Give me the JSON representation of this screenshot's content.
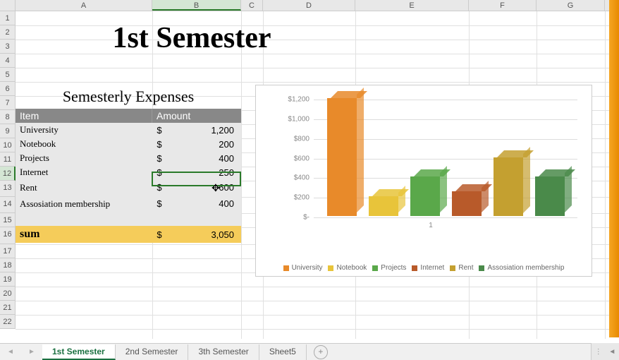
{
  "columns": [
    "A",
    "B",
    "C",
    "D",
    "E",
    "F",
    "G"
  ],
  "active_cell": {
    "col": "B",
    "row": 12
  },
  "title": "1st Semester",
  "table": {
    "title": "Semesterly Expenses",
    "header": {
      "item": "Item",
      "amount": "Amount"
    },
    "rows": [
      {
        "item": "University",
        "currency": "$",
        "amount": "1,200"
      },
      {
        "item": "Notebook",
        "currency": "$",
        "amount": "200"
      },
      {
        "item": "Projects",
        "currency": "$",
        "amount": "400"
      },
      {
        "item": "Internet",
        "currency": "$",
        "amount": "250"
      },
      {
        "item": "Rent",
        "currency": "$",
        "amount": "600"
      },
      {
        "item": "Assosiation membership",
        "currency": "$",
        "amount": "400"
      }
    ],
    "sum": {
      "label": "sum",
      "currency": "$",
      "amount": "3,050"
    }
  },
  "chart_data": {
    "type": "bar",
    "categories": [
      "1"
    ],
    "series": [
      {
        "name": "University",
        "value": 1200,
        "color": "#e88a2a"
      },
      {
        "name": "Notebook",
        "value": 200,
        "color": "#e8c43a"
      },
      {
        "name": "Projects",
        "value": 400,
        "color": "#5aa84a"
      },
      {
        "name": "Internet",
        "value": 250,
        "color": "#b85a2a"
      },
      {
        "name": "Rent",
        "value": 600,
        "color": "#c4a030"
      },
      {
        "name": "Assosiation membership",
        "value": 400,
        "color": "#4a8a4a"
      }
    ],
    "ylim": [
      0,
      1200
    ],
    "y_ticks": [
      "$-",
      "$200",
      "$400",
      "$600",
      "$800",
      "$1,000",
      "$1,200"
    ],
    "xlabel": "1"
  },
  "sheets": {
    "tabs": [
      "1st Semester",
      "2nd Semester",
      "3th Semester",
      "Sheet5"
    ],
    "active": 0
  }
}
